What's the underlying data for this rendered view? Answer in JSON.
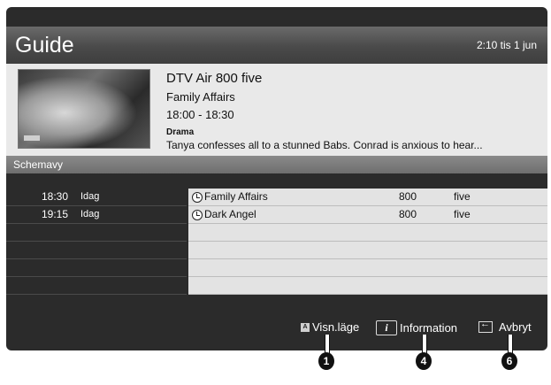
{
  "header": {
    "title": "Guide",
    "clock": "2:10 tis 1 jun"
  },
  "info": {
    "channel": "DTV Air 800 five",
    "program": "Family Affairs",
    "time": "18:00 - 18:30",
    "genre": "Drama",
    "description": "Tanya confesses all to a stunned Babs. Conrad is anxious to hear..."
  },
  "schedule": {
    "heading": "Schemavy",
    "rows": [
      {
        "time": "18:30",
        "day": "Idag",
        "program": "Family Affairs",
        "number": "800",
        "channel": "five"
      },
      {
        "time": "19:15",
        "day": "Idag",
        "program": "Dark Angel",
        "number": "800",
        "channel": "five"
      },
      {
        "time": "",
        "day": "",
        "program": "",
        "number": "",
        "channel": ""
      },
      {
        "time": "",
        "day": "",
        "program": "",
        "number": "",
        "channel": ""
      },
      {
        "time": "",
        "day": "",
        "program": "",
        "number": "",
        "channel": ""
      },
      {
        "time": "",
        "day": "",
        "program": "",
        "number": "",
        "channel": ""
      }
    ]
  },
  "footer": {
    "view_mode_icon": "A",
    "view_mode": "Visn.läge",
    "info_icon": "i",
    "information": "Information",
    "cancel": "Avbryt"
  },
  "callouts": [
    "1",
    "4",
    "6"
  ]
}
